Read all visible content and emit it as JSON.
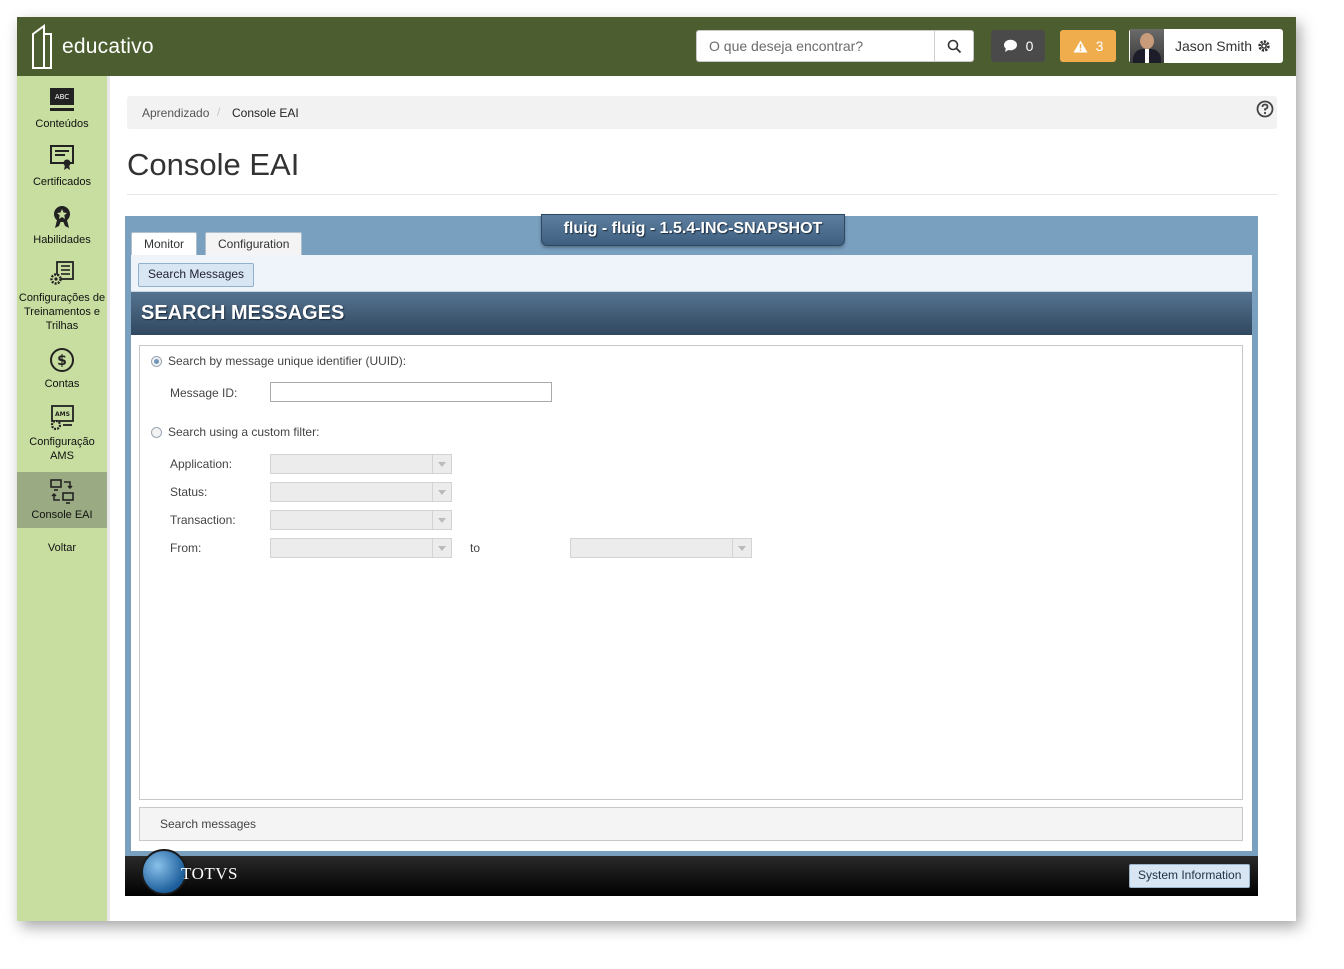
{
  "header": {
    "brand": "educativo",
    "search_placeholder": "O que deseja encontrar?",
    "messages_count": "0",
    "alerts_count": "3",
    "user_name": "Jason Smith"
  },
  "sidebar": {
    "items": [
      {
        "label": "Conteúdos"
      },
      {
        "label": "Certificados"
      },
      {
        "label": "Habilidades"
      },
      {
        "label": "Configurações de Treinamentos e Trilhas"
      },
      {
        "label": "Contas"
      },
      {
        "label": "Configuração AMS"
      },
      {
        "label": "Console EAI"
      },
      {
        "label": "Voltar"
      }
    ]
  },
  "breadcrumb": {
    "parent": "Aprendizado",
    "separator": "/",
    "current": "Console EAI"
  },
  "page": {
    "title": "Console EAI"
  },
  "console": {
    "version": "fluig - fluig - 1.5.4-INC-SNAPSHOT",
    "tabs": [
      {
        "label": "Monitor"
      },
      {
        "label": "Configuration"
      }
    ],
    "subnav_button": "Search Messages",
    "section_title": "SEARCH MESSAGES",
    "form": {
      "uuid_radio_label": "Search by message unique identifier (UUID):",
      "message_id_label": "Message ID:",
      "message_id_value": "",
      "custom_radio_label": "Search using a custom filter:",
      "application_label": "Application:",
      "status_label": "Status:",
      "transaction_label": "Transaction:",
      "from_label": "From:",
      "to_label": "to"
    },
    "status_text": "Search messages",
    "footer_brand": "TOTVS",
    "system_info_button": "System Information"
  },
  "colors": {
    "topbar": "#4c5e2f",
    "sidebar": "#c8dea0",
    "sidebar_active": "#9aaa82",
    "alert_badge": "#f0ad4e",
    "console_frame": "#7aa0c0"
  }
}
